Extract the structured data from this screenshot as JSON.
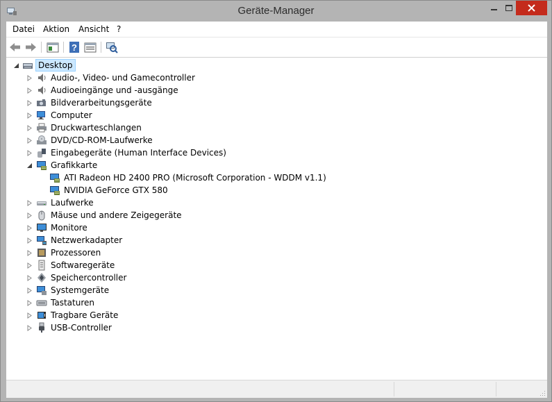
{
  "window": {
    "title": "Geräte-Manager"
  },
  "menu": [
    "Datei",
    "Aktion",
    "Ansicht",
    "?"
  ],
  "toolbar": [
    {
      "name": "back-arrow-icon"
    },
    {
      "name": "forward-arrow-icon"
    },
    {
      "name": "show-hide-console-tree-icon"
    },
    {
      "name": "help-icon"
    },
    {
      "name": "properties-icon"
    },
    {
      "name": "scan-hardware-icon"
    }
  ],
  "tree": {
    "root": "Desktop",
    "categories": [
      {
        "label": "Audio-, Video- und Gamecontroller",
        "icon": "speaker-icon"
      },
      {
        "label": "Audioeingänge und -ausgänge",
        "icon": "speaker-icon"
      },
      {
        "label": "Bildverarbeitungsgeräte",
        "icon": "camera-icon"
      },
      {
        "label": "Computer",
        "icon": "computer-icon"
      },
      {
        "label": "Druckwarteschlangen",
        "icon": "printer-icon"
      },
      {
        "label": "DVD/CD-ROM-Laufwerke",
        "icon": "dvd-drive-icon"
      },
      {
        "label": "Eingabegeräte (Human Interface Devices)",
        "icon": "hid-icon"
      },
      {
        "label": "Grafikkarte",
        "icon": "display-adapter-icon",
        "expanded": true,
        "children": [
          "ATI Radeon HD 2400 PRO (Microsoft Corporation - WDDM v1.1)",
          "NVIDIA GeForce GTX 580"
        ]
      },
      {
        "label": "Laufwerke",
        "icon": "disk-drive-icon"
      },
      {
        "label": "Mäuse und andere Zeigegeräte",
        "icon": "mouse-icon"
      },
      {
        "label": "Monitore",
        "icon": "monitor-icon"
      },
      {
        "label": "Netzwerkadapter",
        "icon": "network-adapter-icon"
      },
      {
        "label": "Prozessoren",
        "icon": "processor-icon"
      },
      {
        "label": "Softwaregeräte",
        "icon": "software-device-icon"
      },
      {
        "label": "Speichercontroller",
        "icon": "storage-controller-icon"
      },
      {
        "label": "Systemgeräte",
        "icon": "system-devices-icon"
      },
      {
        "label": "Tastaturen",
        "icon": "keyboard-icon"
      },
      {
        "label": "Tragbare Geräte",
        "icon": "portable-device-icon"
      },
      {
        "label": "USB-Controller",
        "icon": "usb-icon"
      }
    ]
  }
}
